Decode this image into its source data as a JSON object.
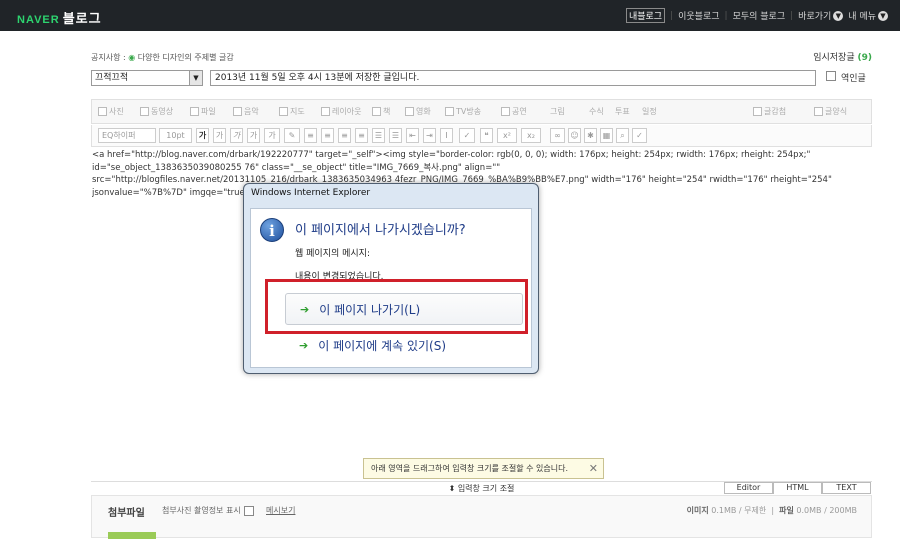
{
  "topbar": {
    "brand_naver": "NAVER",
    "brand_blog": "블로그",
    "nav": [
      "내블로그",
      "이웃블로그",
      "모두의 블로그",
      "바로가기",
      "내 메뉴"
    ]
  },
  "notice": {
    "label": "공지사항 :",
    "text": "다양한 디자인의 주제별 글감"
  },
  "drafts": {
    "label": "임시저장글",
    "count": "(9)"
  },
  "category": {
    "selected": "끄적끄적"
  },
  "title_input": {
    "value": "2013년 11월 5일 오후 4시 13분에 저장한 글입니다."
  },
  "translate_label": "역인글",
  "toolbar1": [
    "사진",
    "동영상",
    "파일",
    "음악",
    "지도",
    "레이아웃",
    "책",
    "영화",
    "TV방송",
    "공연",
    "그림",
    "수식",
    "투표",
    "일정",
    "글감첨",
    "글양식"
  ],
  "toolbar2": {
    "font": "EQ하이퍼",
    "size": "10pt"
  },
  "source_lines": [
    "<a href=\"http://blog.naver.com/drbark/192220777\" target=\"_self\"><img style=\"border-color: rgb(0, 0, 0); width: 176px; height: 254px; rwidth: 176px; rheight: 254px;\"",
    "id=\"se_object_1383635039080255 76\" class=\"__se_object\" title=\"IMG_7669_복사.png\" align=\"\"",
    "src=\"http://blogfiles.naver.net/20131105_216/drbark_1383635034963 4fezr_PNG/IMG_7669_%BA%B9%BB%E7.png\" width=\"176\" height=\"254\" rwidth=\"176\" rheight=\"254\"",
    "jsonvalue=\"%7B%7D\" imgqe=\"true                                                            61453256\"> </a>"
  ],
  "dialog": {
    "window_title": "Windows Internet Explorer",
    "heading": "이 페이지에서 나가시겠습니까?",
    "sub": "웹 페이지의 메시지:",
    "message": "내용이 변경되었습니다.",
    "option_leave": "이 페이지 나가기(L)",
    "option_stay": "이 페이지에 계속 있기(S)"
  },
  "resize_tip": "아래 영역을 드래그하여 입력창 크기를 조절할 수 있습니다.",
  "resize_bar": "입력창 크기 조절",
  "mode_tabs": [
    "Editor",
    "HTML",
    "TEXT"
  ],
  "attach": {
    "title": "첨부파일",
    "option": "첨부사진 촬영정보 표시",
    "view": "메시보기",
    "image_label": "이미지",
    "image_size": "0.1MB",
    "image_limit": "무제한",
    "file_label": "파일",
    "file_size": "0.0MB",
    "file_limit": "200MB"
  }
}
